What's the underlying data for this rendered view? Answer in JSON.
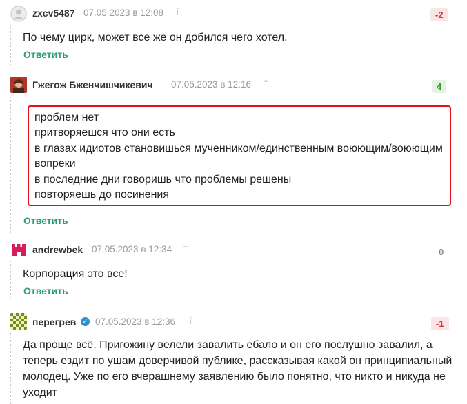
{
  "comments": [
    {
      "author": "zxcv5487",
      "date": "07.05.2023 в 12:08",
      "score": "-2",
      "text": [
        "По чему цирк, может все же он добился чего хотел."
      ],
      "reply_label": "Ответить",
      "avatar": "default-user-icon"
    },
    {
      "author": "Гжегож Бженчишчикевич",
      "date": "07.05.2023 в 12:16",
      "score": "4",
      "text": [
        "проблем нет",
        "притворяешся что они есть",
        "в глазах идиотов становишься мученником/единственным воюющим/воюющим",
        "вопреки",
        "в последние дни говоришь что проблемы решены",
        "повторяешь до посинения"
      ],
      "reply_label": "Ответить",
      "avatar": "portrait-avatar"
    },
    {
      "author": "andrewbek",
      "date": "07.05.2023 в 12:34",
      "score": "0",
      "text": [
        "Корпорация это все!"
      ],
      "reply_label": "Ответить",
      "avatar": "castle-avatar"
    },
    {
      "author": "перегрев",
      "date": "07.05.2023 в 12:36",
      "score": "-1",
      "text": [
        "Да проще всё. Пригожину велели завалить ебало и он его послушно завалил, а",
        "теперь ездит по ушам доверчивой публике, рассказывая какой он принципиальный",
        "молодец. Уже по его вчерашнему заявлению было понятно, что никто и никуда не",
        "уходит"
      ],
      "avatar": "pattern-avatar",
      "verified_icon": "verified-check-icon"
    }
  ],
  "colors": {
    "accent_reply": "#2b9a7a",
    "negative": "#d23a3a",
    "positive": "#3a9a2a",
    "highlight_border": "#e3101a",
    "verified": "#2d8fd0"
  },
  "icons": {
    "pin": "pin-icon"
  }
}
